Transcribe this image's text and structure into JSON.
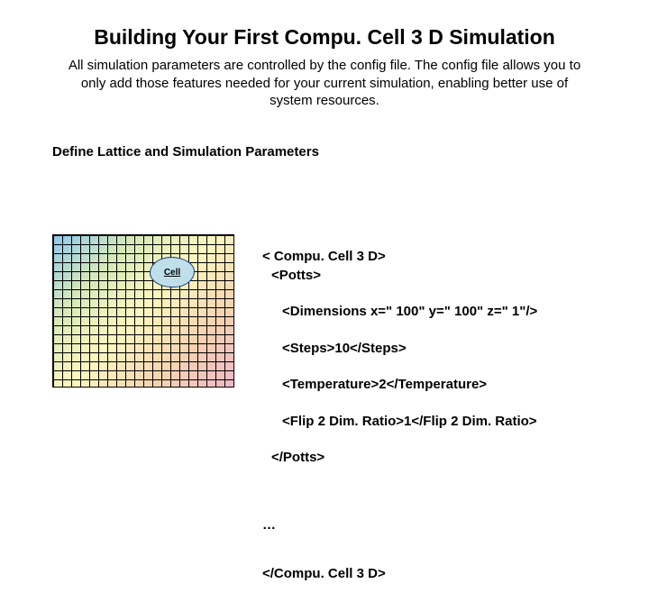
{
  "title": "Building Your First Compu. Cell 3 D Simulation",
  "intro": "All simulation parameters are controlled by the config file.  The config file allows you to only add those features needed for your current simulation, enabling better use of system resources.",
  "section_header": "Define Lattice and Simulation Parameters",
  "cell_label": "Cell",
  "xml": {
    "l1": "< Compu. Cell 3 D>",
    "l2": "<Potts>",
    "l3": "<Dimensions x=\" 100\" y=\" 100\" z=\" 1\"/>",
    "l4": "<Steps>10</Steps>",
    "l5": "<Temperature>2</Temperature>",
    "l6": "<Flip 2 Dim. Ratio>1</Flip 2 Dim. Ratio>",
    "l7": "</Potts>",
    "l8": "…",
    "l9": "</Compu. Cell 3 D>"
  }
}
